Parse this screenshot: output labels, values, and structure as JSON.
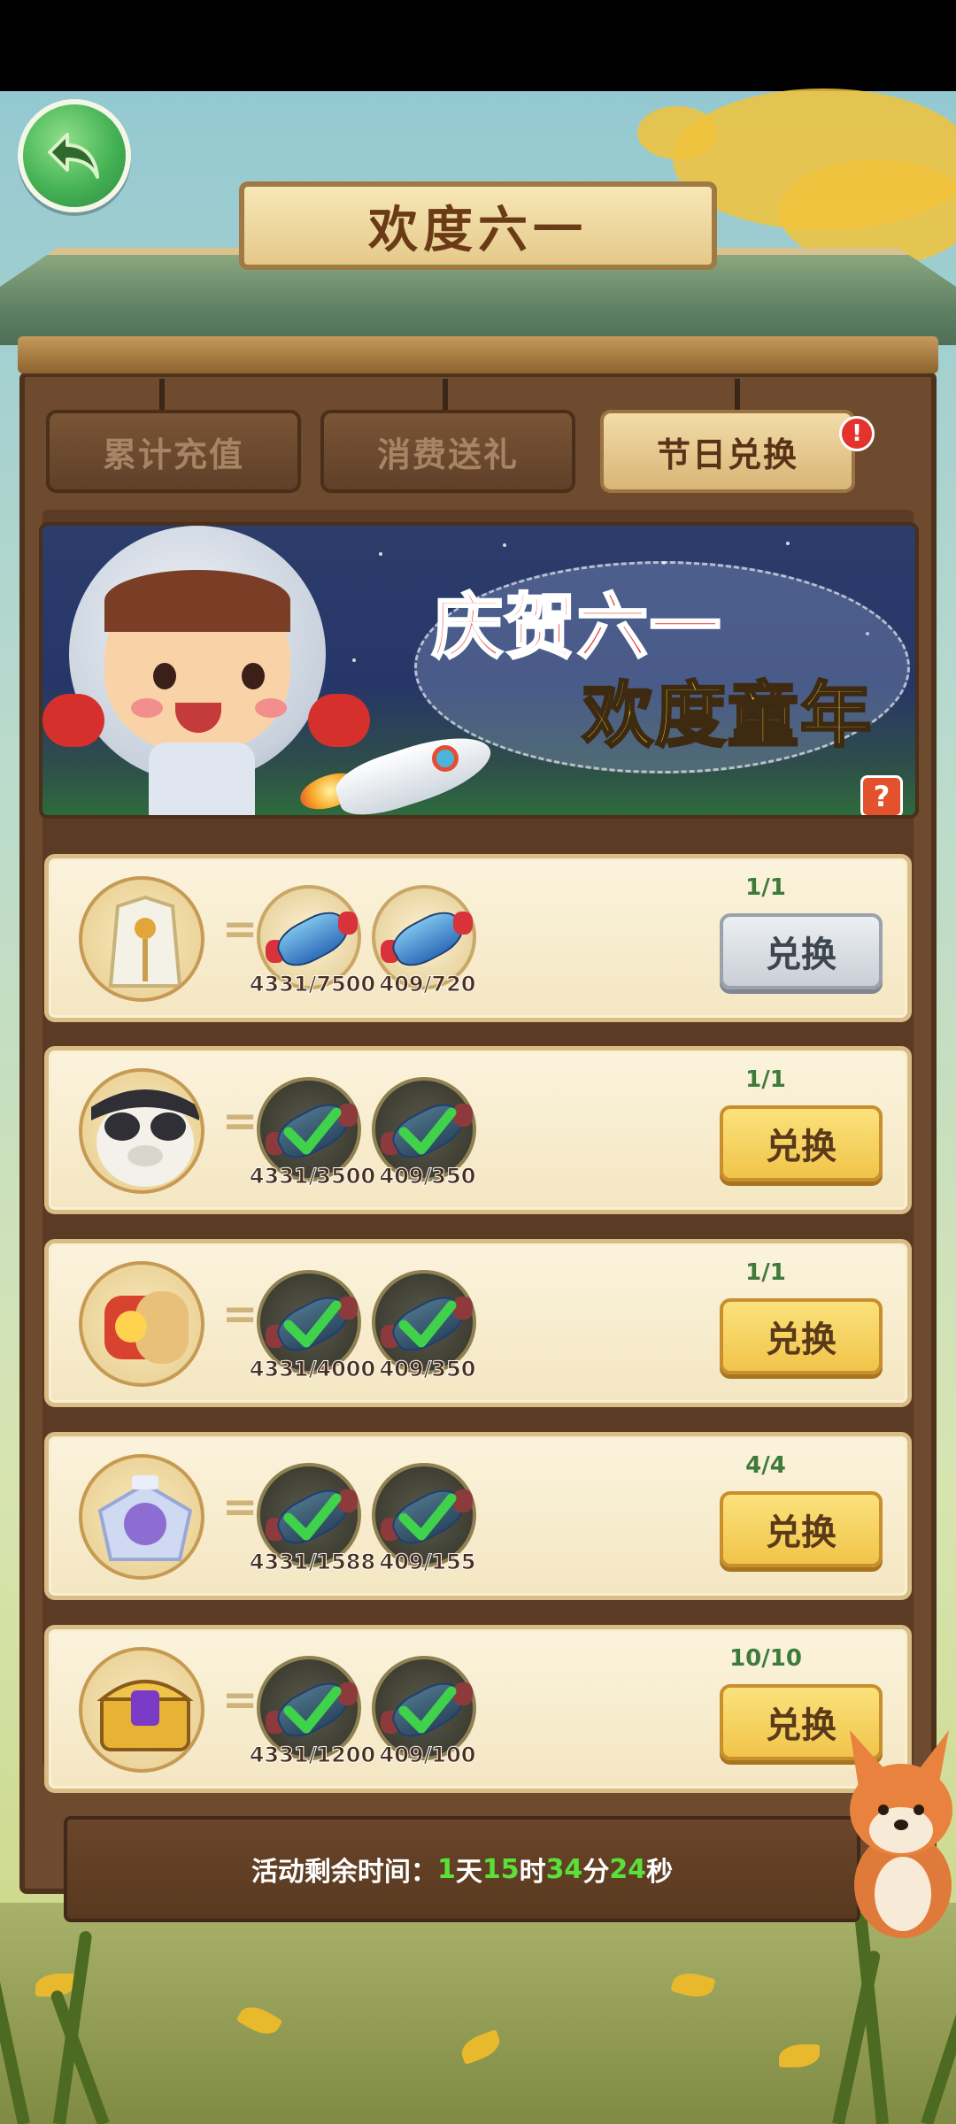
{
  "title": "欢度六一",
  "tabs": [
    {
      "label": "累计充值",
      "active": false
    },
    {
      "label": "消费送礼",
      "active": false
    },
    {
      "label": "节日兑换",
      "active": true
    }
  ],
  "tab_badge": "!",
  "banner": {
    "line1": "庆贺六一",
    "line2": "欢度童年",
    "help": "?"
  },
  "rows": [
    {
      "reward_icon": "white-robe-costume-icon",
      "cost1": "4331/7500",
      "cost2": "409/720",
      "cost1_done": false,
      "cost2_done": false,
      "limit": "1/1",
      "button": "兑换",
      "button_disabled": true
    },
    {
      "reward_icon": "panda-avatar-icon",
      "cost1": "4331/3500",
      "cost2": "409/350",
      "cost1_done": true,
      "cost2_done": true,
      "limit": "1/1",
      "button": "兑换",
      "button_disabled": false
    },
    {
      "reward_icon": "fire-scroll-icon",
      "cost1": "4331/4000",
      "cost2": "409/350",
      "cost1_done": true,
      "cost2_done": true,
      "limit": "1/1",
      "button": "兑换",
      "button_disabled": false
    },
    {
      "reward_icon": "crystal-crest-frame-icon",
      "cost1": "4331/1588",
      "cost2": "409/155",
      "cost1_done": true,
      "cost2_done": true,
      "limit": "4/4",
      "button": "兑换",
      "button_disabled": false
    },
    {
      "reward_icon": "gem-treasure-chest-icon",
      "cost1": "4331/1200",
      "cost2": "409/100",
      "cost1_done": true,
      "cost2_done": true,
      "limit": "10/10",
      "button": "兑换",
      "button_disabled": false
    }
  ],
  "countdown": {
    "label": "活动剩余时间：",
    "days": "1",
    "days_unit": "天",
    "hours": "15",
    "hours_unit": "时",
    "minutes": "34",
    "minutes_unit": "分",
    "seconds": "24",
    "seconds_unit": "秒"
  },
  "colors": {
    "accent_green": "#5be03a",
    "button_gold": "#f1c44a",
    "wood": "#6e4a2e"
  }
}
